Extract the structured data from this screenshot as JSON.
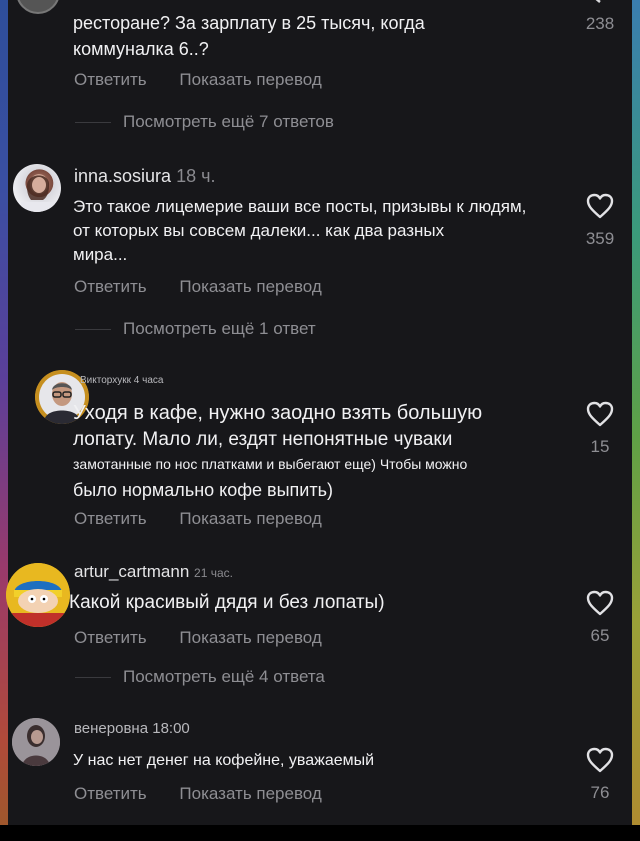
{
  "colors": {
    "panel": "#17171a",
    "text": "#f1f1f3",
    "muted": "#8e8e93"
  },
  "top_comment": {
    "lines": [
      "ресторане? За зарплату в 25 тысяч, когда",
      "коммуналка 6..?"
    ],
    "likes": "238",
    "reply": "Ответить",
    "translate": "Показать перевод",
    "more": "Посмотреть ещё 7 ответов"
  },
  "comments": [
    {
      "user": "inna.sosiura",
      "time": "18 ч.",
      "lines": [
        "Это такое лицемерие ваши все посты, призывы к людям,",
        "от которых вы совсем далеки... как два разных",
        "мира..."
      ],
      "likes": "359",
      "reply": "Ответить",
      "translate": "Показать перевод",
      "more": "Посмотреть ещё 1 ответ",
      "avatar_icon": "woman-photo-icon"
    },
    {
      "user": "Викторхукк",
      "time": "4 часа",
      "lines": [
        "Уходя в кафе, нужно заодно взять большую",
        "лопату. Мало ли, ездят непонятные чуваки",
        "замотанные по нос платками и выбегают еще) Чтобы можно",
        "было нормально кофе выпить)"
      ],
      "likes": "15",
      "reply": "Ответить",
      "translate": "Показать перевод",
      "avatar_icon": "man-glasses-photo-icon"
    },
    {
      "user": "artur_cartmann",
      "time": "21 час.",
      "lines": [
        "Какой красивый дядя и без лопаты)"
      ],
      "likes": "65",
      "reply": "Ответить",
      "translate": "Показать перевод",
      "more": "Посмотреть ещё 4 ответа",
      "avatar_icon": "cartoon-character-icon"
    },
    {
      "user": "венеровна",
      "time": "18:00",
      "lines": [
        "У нас нет денег на кофейне, уважаемый"
      ],
      "likes": "76",
      "reply": "Ответить",
      "translate": "Показать перевод",
      "avatar_icon": "person-photo-icon"
    }
  ]
}
